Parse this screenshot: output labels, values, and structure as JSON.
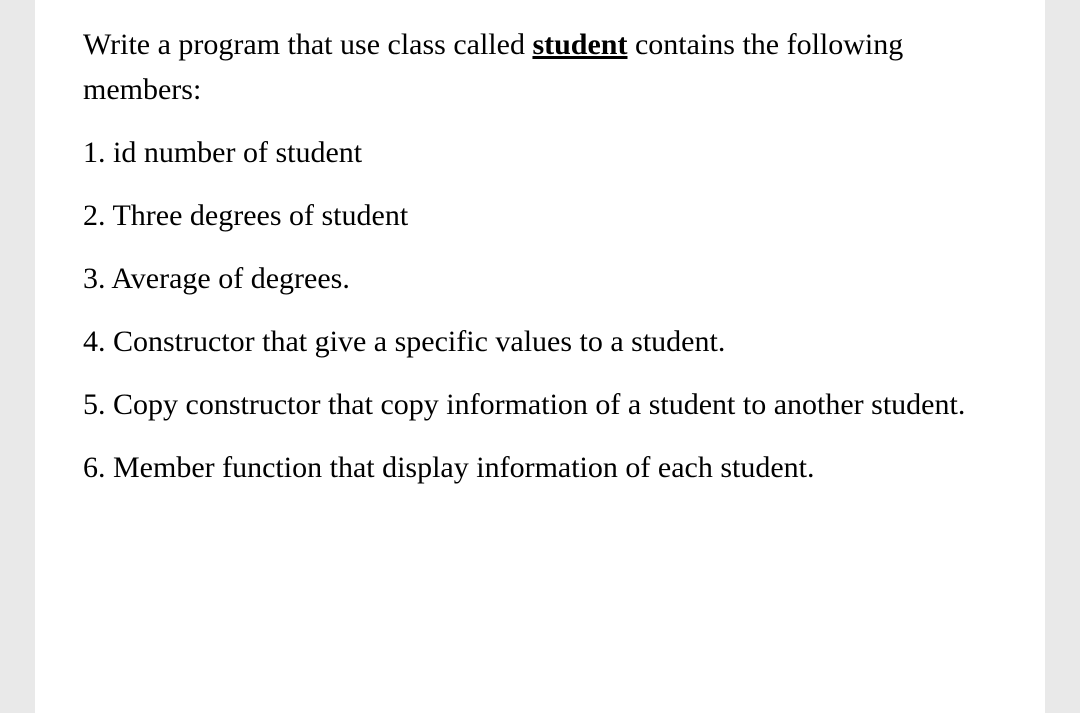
{
  "intro": {
    "prefix": "Write a program that use class called ",
    "keyword": "student",
    "suffix": " contains the following members:"
  },
  "items": [
    "1. id number of student",
    "2. Three degrees of student",
    "3. Average of degrees.",
    "4. Constructor that give a specific values to a student.",
    "5. Copy constructor that copy information of a student to another student.",
    "6. Member function that display information of each student."
  ]
}
